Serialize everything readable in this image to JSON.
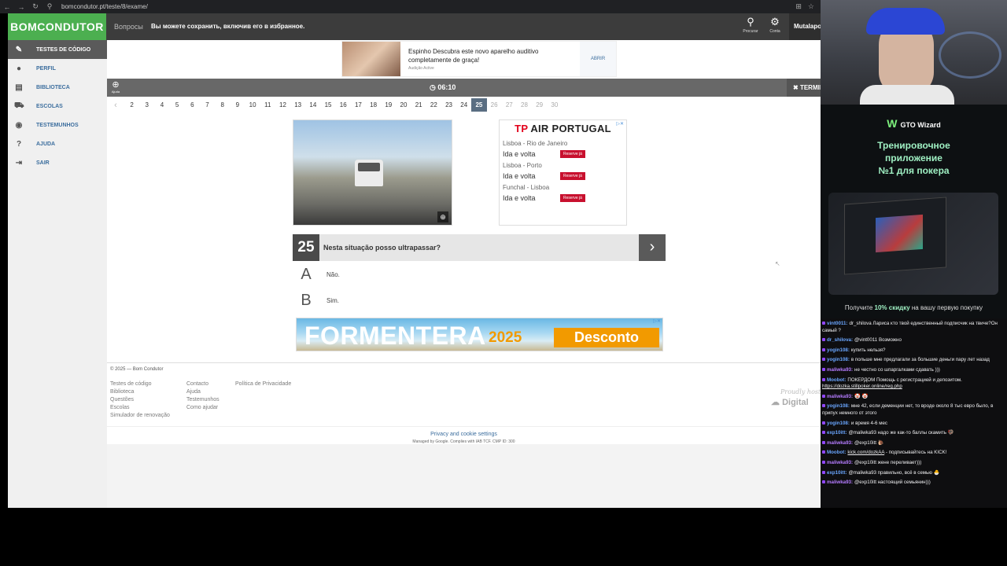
{
  "browser": {
    "url": "bomcondutor.pt/teste/8/exame/"
  },
  "site": {
    "logo": "BOMCONDUTOR",
    "nav_questions": "Вопросы",
    "nav_save": "Вы можете сохранить, включив его в избранное.",
    "search_label": "Procurar",
    "account_label": "Conta",
    "user_name": "Mutalapo",
    "sidebar": [
      {
        "label": "TESTES DE CÓDIGO",
        "icon": "pencil-icon",
        "active": true
      },
      {
        "label": "PERFIL",
        "icon": "user-icon",
        "active": false
      },
      {
        "label": "BIBLIOTECA",
        "icon": "book-icon",
        "active": false
      },
      {
        "label": "ESCOLAS",
        "icon": "car-icon",
        "active": false
      },
      {
        "label": "TESTEMUNHOS",
        "icon": "chat-icon",
        "active": false
      },
      {
        "label": "AJUDA",
        "icon": "help-icon",
        "active": false
      },
      {
        "label": "SAIR",
        "icon": "logout-icon",
        "active": false
      }
    ]
  },
  "ad_top": {
    "text": "Espinho Descubra este novo aparelho auditivo completamente de graça!",
    "source": "Audição Active",
    "button": "ABRIR"
  },
  "exam": {
    "help_label": "Ajuda",
    "timer": "06:10",
    "terminate": "TERMINAR",
    "pages": [
      "2",
      "3",
      "4",
      "5",
      "6",
      "7",
      "8",
      "9",
      "10",
      "11",
      "12",
      "13",
      "14",
      "15",
      "16",
      "17",
      "18",
      "19",
      "20",
      "21",
      "22",
      "23",
      "24",
      "25",
      "26",
      "27",
      "28",
      "29",
      "30"
    ],
    "current_page": "25",
    "question_number": "25",
    "question_text": "Nesta situação posso ultrapassar?",
    "answers": [
      {
        "letter": "A",
        "text": "Não."
      },
      {
        "letter": "B",
        "text": "Sim."
      }
    ]
  },
  "ad_side": {
    "brand_prefix": "TP",
    "brand": "AIR PORTUGAL",
    "routes": [
      {
        "route": "Lisboa - Rio de Janeiro",
        "type": "Ida e volta",
        "button": "Reserve já"
      },
      {
        "route": "Lisboa - Porto",
        "type": "Ida e volta",
        "button": "Reserve já"
      },
      {
        "route": "Funchal - Lisboa",
        "type": "Ida e volta",
        "button": "Reserve já"
      }
    ]
  },
  "ad_banner": {
    "title": "FORMENTERA",
    "year": "2025",
    "cta": "Desconto"
  },
  "footer": {
    "copyright": "© 2025 — Bom Condutor",
    "col1": [
      "Testes de código",
      "Biblioteca",
      "Questões",
      "Escolas",
      "Simulador de renovação"
    ],
    "col2": [
      "Contacto",
      "Ajuda",
      "Testemunhos",
      "Como ajudar"
    ],
    "col3": [
      "Política de Privacidade"
    ],
    "powered_line1": "Proudly hosted",
    "powered_line2": "Digital",
    "privacy": "Privacy and cookie settings",
    "managed": "Managed by Google. Complies with IAB TCF. CMP ID: 300"
  },
  "gto": {
    "brand": "GTO Wizard",
    "headline_1": "Тренировочное",
    "headline_2": "приложение",
    "headline_3": "№1 для покера",
    "promo_pre": "Получите",
    "promo_hl": "10% скидку",
    "promo_post": "на вашу первую покупку"
  },
  "chat": [
    {
      "user": "vint0011:",
      "text": "dr_shilova Лариса кто твой единственный подписчик на твиче?Он самый ?",
      "color": "#6aa6ff"
    },
    {
      "user": "dr_shilova:",
      "text": "@vint0011 Возможно",
      "color": "#6aa6ff"
    },
    {
      "user": "yogin108:",
      "text": "купить нельзя?",
      "color": "#6aa6ff"
    },
    {
      "user": "yogin108:",
      "text": "в польше мне предлагали за большие деньги пару лет назад",
      "color": "#6aa6ff"
    },
    {
      "user": "maliwka93:",
      "text": "не честно со шпаргалками сдавать )))",
      "color": "#b57cff"
    },
    {
      "user": "Moobot:",
      "text": "ПОКЕРДОМ Помощь с регистрацией и депозитом.",
      "link": "https://dozka.stillpoker.online/reg.php",
      "color": "#6aa6ff"
    },
    {
      "user": "maliwka93:",
      "text": "🤡 🤡",
      "color": "#b57cff"
    },
    {
      "user": "yogin108:",
      "text": "мне 42, если деменции нет, то вроде около 8 тыс евро было, в припух немного от этого",
      "color": "#6aa6ff"
    },
    {
      "user": "yogin108:",
      "text": "и время 4-6 мес",
      "color": "#6aa6ff"
    },
    {
      "user": "exp10itt:",
      "text": "@maliwka93 надо же как-то баллы скамить 🦃",
      "color": "#6aa6ff"
    },
    {
      "user": "maliwka93:",
      "text": "@exp10itt 🐌",
      "color": "#b57cff"
    },
    {
      "user": "Moobot:",
      "text": "- подписывайтесь на KICK!",
      "link": "kick.com/dozkAA",
      "color": "#6aa6ff"
    },
    {
      "user": "maliwka93:",
      "text": "@exp10itt жене переливает)))",
      "color": "#b57cff"
    },
    {
      "user": "exp10itt:",
      "text": "@maliwka93 правильно, всё в семью 🐣",
      "color": "#6aa6ff"
    },
    {
      "user": "maliwka93:",
      "text": "@exp10itt настоящий семьянин)))",
      "color": "#b57cff"
    }
  ]
}
